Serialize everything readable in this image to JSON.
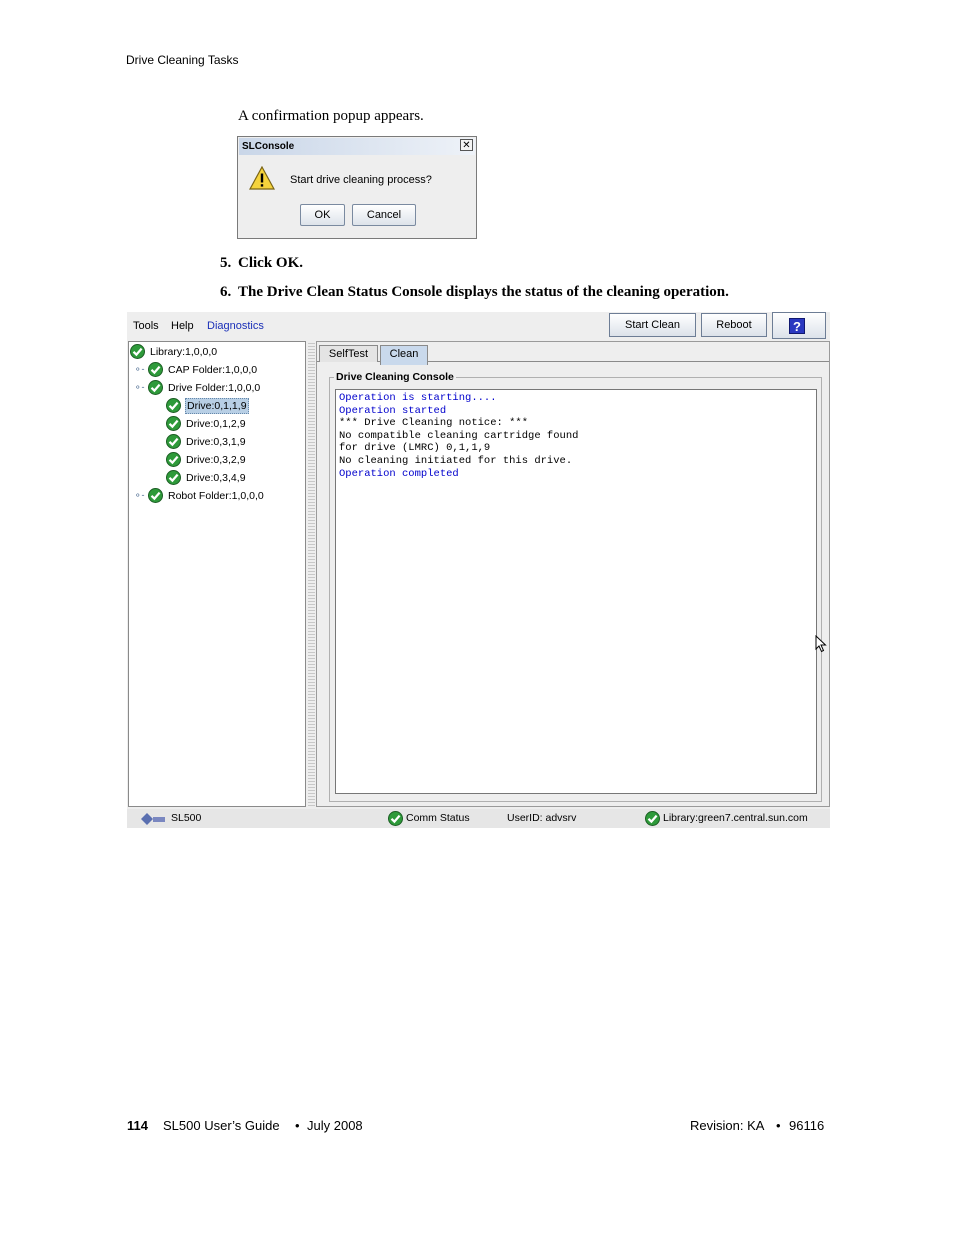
{
  "header": {
    "section": "Drive Cleaning Tasks"
  },
  "intro_text": "A confirmation popup appears.",
  "dialog": {
    "title": "SLConsole",
    "close": "✕",
    "message": "Start drive cleaning process?",
    "ok_label": "OK",
    "cancel_label": "Cancel"
  },
  "steps": [
    {
      "number": "5.",
      "text": "Click OK."
    },
    {
      "number": "6.",
      "text": "The Drive Clean Status Console displays the status of the cleaning operation."
    }
  ],
  "app": {
    "menu": {
      "tools": "Tools",
      "help": "Help",
      "diagnostics": "Diagnostics"
    },
    "toolbar": {
      "start_clean": "Start Clean",
      "reboot": "Reboot",
      "help": "?"
    },
    "tree": [
      {
        "label": "Library:1,0,0,0"
      },
      {
        "label": "CAP Folder:1,0,0,0"
      },
      {
        "label": "Drive Folder:1,0,0,0"
      },
      {
        "label": "Drive:0,1,1,9"
      },
      {
        "label": "Drive:0,1,2,9"
      },
      {
        "label": "Drive:0,3,1,9"
      },
      {
        "label": "Drive:0,3,2,9"
      },
      {
        "label": "Drive:0,3,4,9"
      },
      {
        "label": "Robot Folder:1,0,0,0"
      }
    ],
    "tabs": {
      "selftest": "SelfTest",
      "clean": "Clean"
    },
    "console_title": "Drive Cleaning Console",
    "console_lines": [
      {
        "text": "Operation is starting....",
        "color": "#0000cc"
      },
      {
        "text": "Operation started",
        "color": "#0000cc"
      },
      {
        "text": "*** Drive Cleaning notice: ***",
        "color": "#000000"
      },
      {
        "text": "No compatible cleaning cartridge found",
        "color": "#000000"
      },
      {
        "text": "for drive (LMRC) 0,1,1,9",
        "color": "#000000"
      },
      {
        "text": "No cleaning initiated for this drive.",
        "color": "#000000"
      },
      {
        "text": "Operation completed",
        "color": "#0000cc"
      }
    ],
    "status": {
      "product": "SL500",
      "comm_status": "Comm Status",
      "user_id": "UserID: advsrv",
      "library": "Library:green7.central.sun.com"
    }
  },
  "footer": {
    "page_number": "114",
    "title": "SL500 User’s Guide",
    "bullet": "•",
    "date": "July 2008",
    "revision": "Revision: KA",
    "doc_number": "96116"
  }
}
